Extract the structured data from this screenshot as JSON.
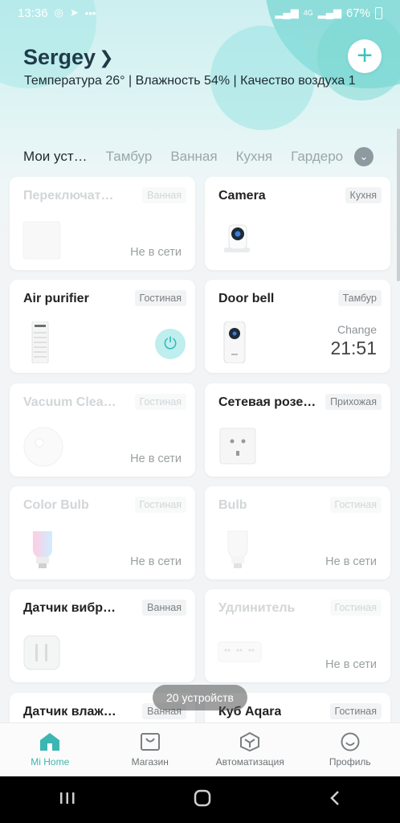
{
  "status_bar": {
    "time": "13:36",
    "battery": "67%",
    "notif_icons": [
      "whatsapp-icon",
      "telegram-icon",
      "more-icon"
    ],
    "sys_icons": [
      "signal-icon",
      "4g-icon",
      "signal-icon",
      "battery-icon"
    ]
  },
  "header": {
    "home_name": "Sergey",
    "environment": "Температура 26° | Влажность 54% | Качество воздуха 1",
    "add_button_icon": "plus-icon"
  },
  "rooms": {
    "tabs": [
      "Мои уст…",
      "Тамбур",
      "Ванная",
      "Кухня",
      "Гардеро"
    ],
    "active_index": 0,
    "expand_icon": "chevron-down-icon"
  },
  "devices": [
    {
      "name": "Переключат…",
      "room": "Ванная",
      "status": "Не в сети",
      "online": false,
      "icon": "switch-icon"
    },
    {
      "name": "Camera",
      "room": "Кухня",
      "status": "",
      "online": true,
      "icon": "camera-icon"
    },
    {
      "name": "Air purifier",
      "room": "Гостиная",
      "status": "",
      "online": true,
      "icon": "air-purifier-icon"
    },
    {
      "name": "Door bell",
      "room": "Тамбур",
      "status": "",
      "online": true,
      "icon": "doorbell-icon",
      "change_label": "Change",
      "change_time": "21:51"
    },
    {
      "name": "Vacuum Clea…",
      "room": "Гостиная",
      "status": "Не в сети",
      "online": false,
      "icon": "vacuum-icon"
    },
    {
      "name": "Сетевая розе…",
      "room": "Прихожая",
      "status": "",
      "online": true,
      "icon": "outlet-icon"
    },
    {
      "name": "Color Bulb",
      "room": "Гостиная",
      "status": "Не в сети",
      "online": false,
      "icon": "color-bulb-icon"
    },
    {
      "name": "Bulb",
      "room": "Гостиная",
      "status": "Не в сети",
      "online": false,
      "icon": "bulb-icon"
    },
    {
      "name": "Датчик вибр…",
      "room": "Ванная",
      "status": "",
      "online": true,
      "icon": "vibration-sensor-icon"
    },
    {
      "name": "Удлинитель",
      "room": "Гостиная",
      "status": "Не в сети",
      "online": false,
      "icon": "power-strip-icon"
    },
    {
      "name": "Датчик влаж…",
      "room": "Ванная",
      "status": "",
      "online": true,
      "icon": "humidity-sensor-icon"
    },
    {
      "name": "Куб Aqara",
      "room": "Гостиная",
      "status": "",
      "online": true,
      "icon": "cube-icon"
    }
  ],
  "device_count": "20 устройств",
  "bottom_nav": [
    {
      "label": "Mi Home",
      "icon": "home-icon",
      "active": true
    },
    {
      "label": "Магазин",
      "icon": "store-icon",
      "active": false
    },
    {
      "label": "Автоматизация",
      "icon": "automation-icon",
      "active": false
    },
    {
      "label": "Профиль",
      "icon": "profile-icon",
      "active": false
    }
  ],
  "colors": {
    "accent": "#3bb6b3",
    "power_bg": "#bfeeee"
  }
}
